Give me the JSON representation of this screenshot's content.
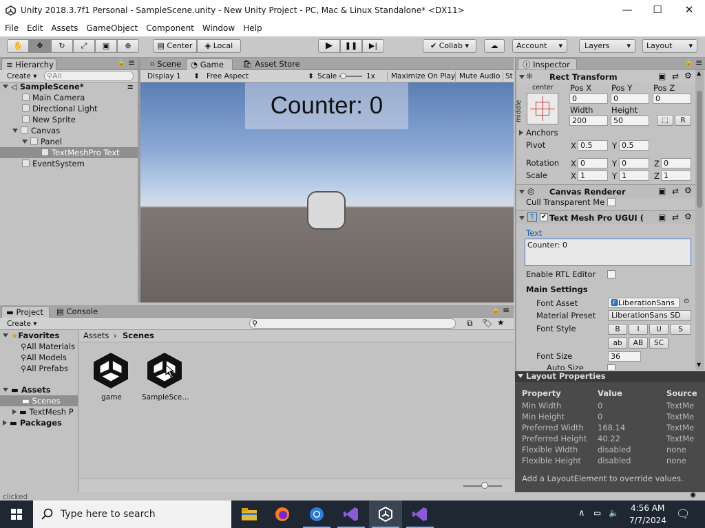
{
  "window": {
    "title": "Unity 2018.3.7f1 Personal - SampleScene.unity - New Unity Project - PC, Mac & Linux Standalone* <DX11>",
    "minimize": "—",
    "maximize": "☐",
    "close": "✕"
  },
  "menu": [
    "File",
    "Edit",
    "Assets",
    "GameObject",
    "Component",
    "Window",
    "Help"
  ],
  "toolbar": {
    "center_label": "Center",
    "local_label": "Local",
    "collab_label": "Collab ▾",
    "account_label": "Account",
    "layers_label": "Layers",
    "layout_label": "Layout"
  },
  "hierarchy": {
    "tab": "Hierarchy",
    "create": "Create",
    "search_placeholder": "All",
    "scene": "SampleScene*",
    "items": [
      "Main Camera",
      "Directional Light",
      "New Sprite",
      "Canvas",
      "Panel",
      "TextMeshPro Text",
      "EventSystem"
    ]
  },
  "game": {
    "tab_scene": "Scene",
    "tab_game": "Game",
    "tab_store": "Asset Store",
    "display": "Display 1",
    "aspect": "Free Aspect",
    "scale_label": "Scale",
    "scale_value": "1x",
    "maximize": "Maximize On Play",
    "mute": "Mute Audio",
    "stats": "St",
    "counter_text": "Counter: 0"
  },
  "inspector": {
    "tab": "Inspector",
    "rect_transform": "Rect Transform",
    "anchor_center": "center",
    "anchor_middle": "middle",
    "pos_x_label": "Pos X",
    "pos_y_label": "Pos Y",
    "pos_z_label": "Pos Z",
    "pos_x": "0",
    "pos_y": "0",
    "pos_z": "0",
    "width_label": "Width",
    "height_label": "Height",
    "width": "200",
    "height": "50",
    "r_button": "R",
    "anchors": "Anchors",
    "pivot": "Pivot",
    "pivot_x": "0.5",
    "pivot_y": "0.5",
    "rotation": "Rotation",
    "rot_x": "0",
    "rot_y": "0",
    "rot_z": "0",
    "scale": "Scale",
    "scale_x": "1",
    "scale_y": "1",
    "scale_z": "1",
    "x": "X",
    "y": "Y",
    "z": "Z",
    "canvas_renderer": "Canvas Renderer",
    "cull": "Cull Transparent Me",
    "tmp": "Text Mesh Pro UGUI (",
    "text_label": "Text",
    "text_value": "Counter: 0",
    "rtl": "Enable RTL Editor",
    "main_settings": "Main Settings",
    "font_asset_label": "Font Asset",
    "font_asset": "LiberationSans",
    "material_label": "Material Preset",
    "material": "LiberationSans SD",
    "font_style_label": "Font Style",
    "style_buttons": [
      "B",
      "I",
      "U",
      "S",
      "ab",
      "AB",
      "SC"
    ],
    "font_size_label": "Font Size",
    "font_size": "36",
    "auto_size": "Auto Size"
  },
  "layout_props": {
    "title": "Layout Properties",
    "headers": [
      "Property",
      "Value",
      "Source"
    ],
    "rows": [
      [
        "Min Width",
        "0",
        "TextMe"
      ],
      [
        "Min Height",
        "0",
        "TextMe"
      ],
      [
        "Preferred Width",
        "168.14",
        "TextMe"
      ],
      [
        "Preferred Height",
        "40.22",
        "TextMe"
      ],
      [
        "Flexible Width",
        "disabled",
        "none"
      ],
      [
        "Flexible Height",
        "disabled",
        "none"
      ]
    ],
    "footer": "Add a LayoutElement to override values."
  },
  "project": {
    "tab_project": "Project",
    "tab_console": "Console",
    "create": "Create",
    "favorites": "Favorites",
    "fav_items": [
      "All Materials",
      "All Models",
      "All Prefabs"
    ],
    "assets": "Assets",
    "asset_items": [
      "Scenes",
      "TextMesh P"
    ],
    "packages": "Packages",
    "breadcrumb_root": "Assets",
    "breadcrumb_current": "Scenes",
    "files": [
      "game",
      "SampleSce…"
    ]
  },
  "status": "clicked",
  "taskbar": {
    "search_placeholder": "Type here to search",
    "time": "4:56 AM",
    "date": "7/7/2024"
  },
  "colors": {
    "unity_gray": "#c2c2c2",
    "selection": "#8f8f8f",
    "taskbar": "#1f2733",
    "link_blue": "#1a5fb4"
  }
}
